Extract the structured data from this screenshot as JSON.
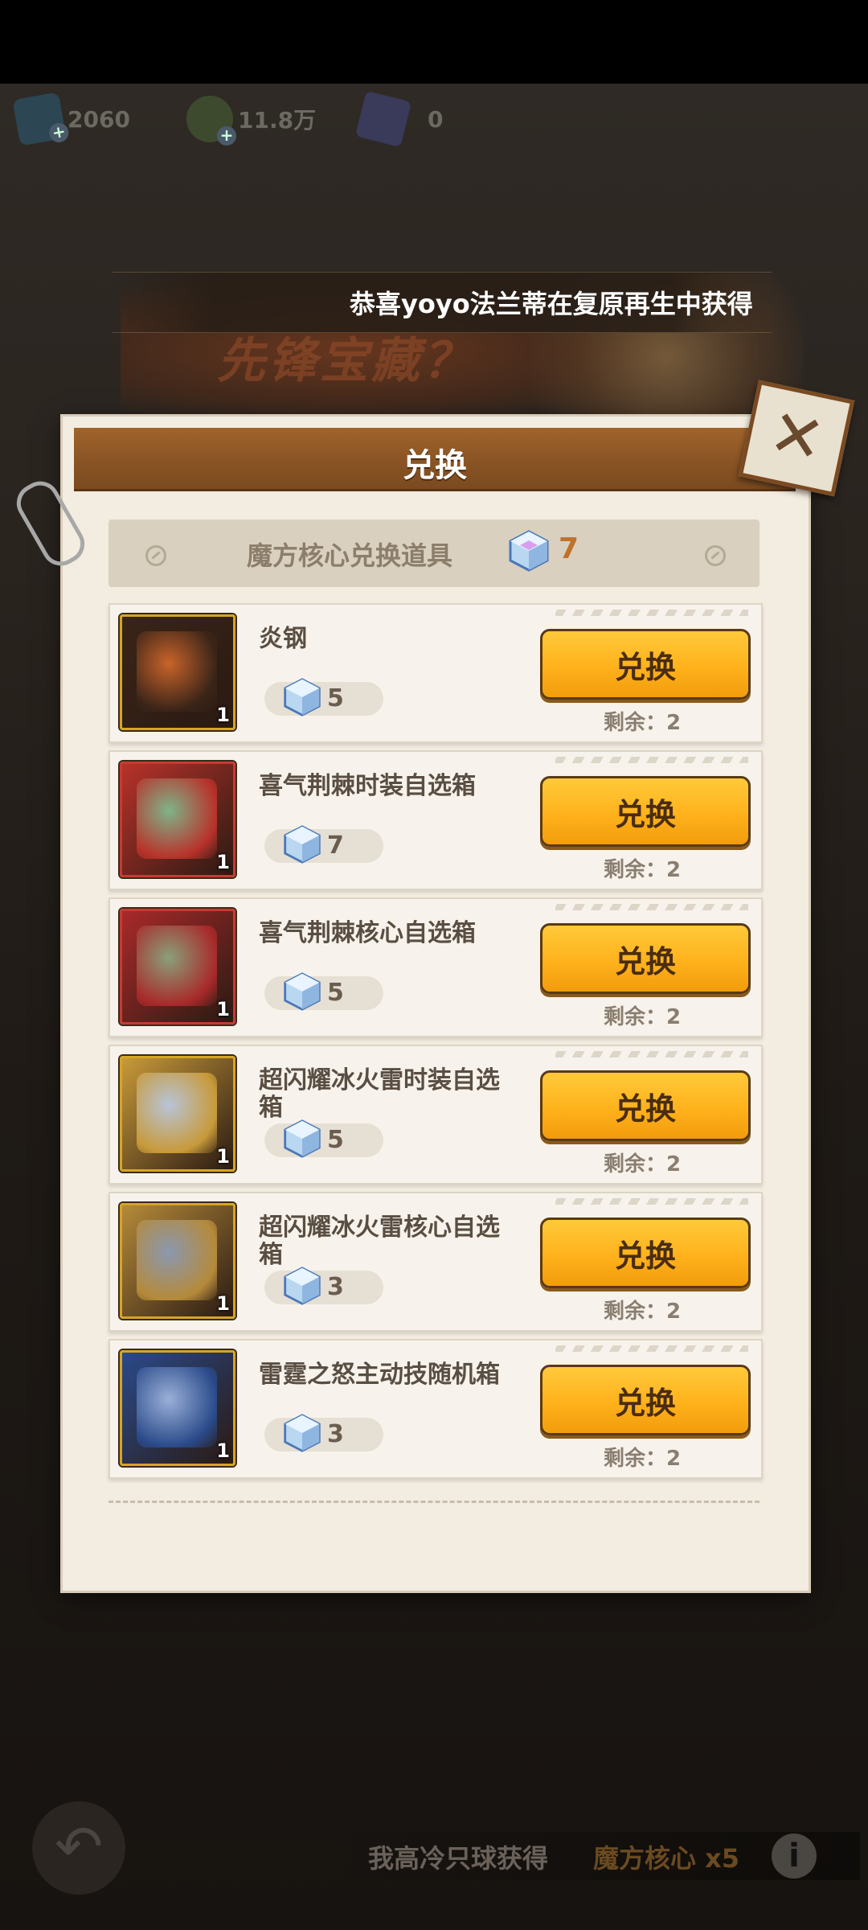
{
  "resources": [
    {
      "icon": "blue-card-icon",
      "value": "2060"
    },
    {
      "icon": "gold-coin-icon",
      "value": "11.8万"
    },
    {
      "icon": "ticket-icon",
      "value": "0"
    }
  ],
  "ticker": {
    "text": "恭喜yoyo法兰蒂在复原再生中获得"
  },
  "banner": {
    "title": "先锋宝藏？"
  },
  "dialog": {
    "title": "兑换",
    "close_icon": "close-icon",
    "subheader": {
      "label": "魔方核心兑换道具",
      "currency_icon": "cube-gem-icon",
      "currency_count": "7"
    },
    "items": [
      {
        "name": "炎钢",
        "qty": "1",
        "cost": "5",
        "button": "兑换",
        "remaining": "剩余：2",
        "colors": [
          "#c9642a",
          "#3a2418"
        ],
        "frame": "#d6a524"
      },
      {
        "name": "喜气荆棘时装自选箱",
        "qty": "1",
        "cost": "7",
        "button": "兑换",
        "remaining": "剩余：2",
        "colors": [
          "#7fb48a",
          "#b8322a"
        ],
        "frame": "#c83a32"
      },
      {
        "name": "喜气荆棘核心自选箱",
        "qty": "1",
        "cost": "5",
        "button": "兑换",
        "remaining": "剩余：2",
        "colors": [
          "#8aa07a",
          "#a82a2a"
        ],
        "frame": "#c83a32"
      },
      {
        "name": "超闪耀冰火雷时装自选箱",
        "qty": "1",
        "cost": "5",
        "button": "兑换",
        "remaining": "剩余：2",
        "colors": [
          "#b7c4d8",
          "#c89a3a"
        ],
        "frame": "#d6a524"
      },
      {
        "name": "超闪耀冰火雷核心自选箱",
        "qty": "1",
        "cost": "3",
        "button": "兑换",
        "remaining": "剩余：2",
        "colors": [
          "#8a98b0",
          "#b58a3a"
        ],
        "frame": "#d6a524"
      },
      {
        "name": "雷霆之怒主动技随机箱",
        "qty": "1",
        "cost": "3",
        "button": "兑换",
        "remaining": "剩余：2",
        "colors": [
          "#9ab0d8",
          "#2a4a8a"
        ],
        "frame": "#d6a524"
      }
    ]
  },
  "bottom": {
    "back_icon": "back-arrow-icon",
    "message_prefix": "我高冷只球获得",
    "message_item": "魔方核心 x5",
    "info_icon": "info-icon"
  },
  "theme": {
    "accent": "#ffb21c",
    "header_brown": "#8a5424",
    "panel_bg": "#f3ece0"
  }
}
